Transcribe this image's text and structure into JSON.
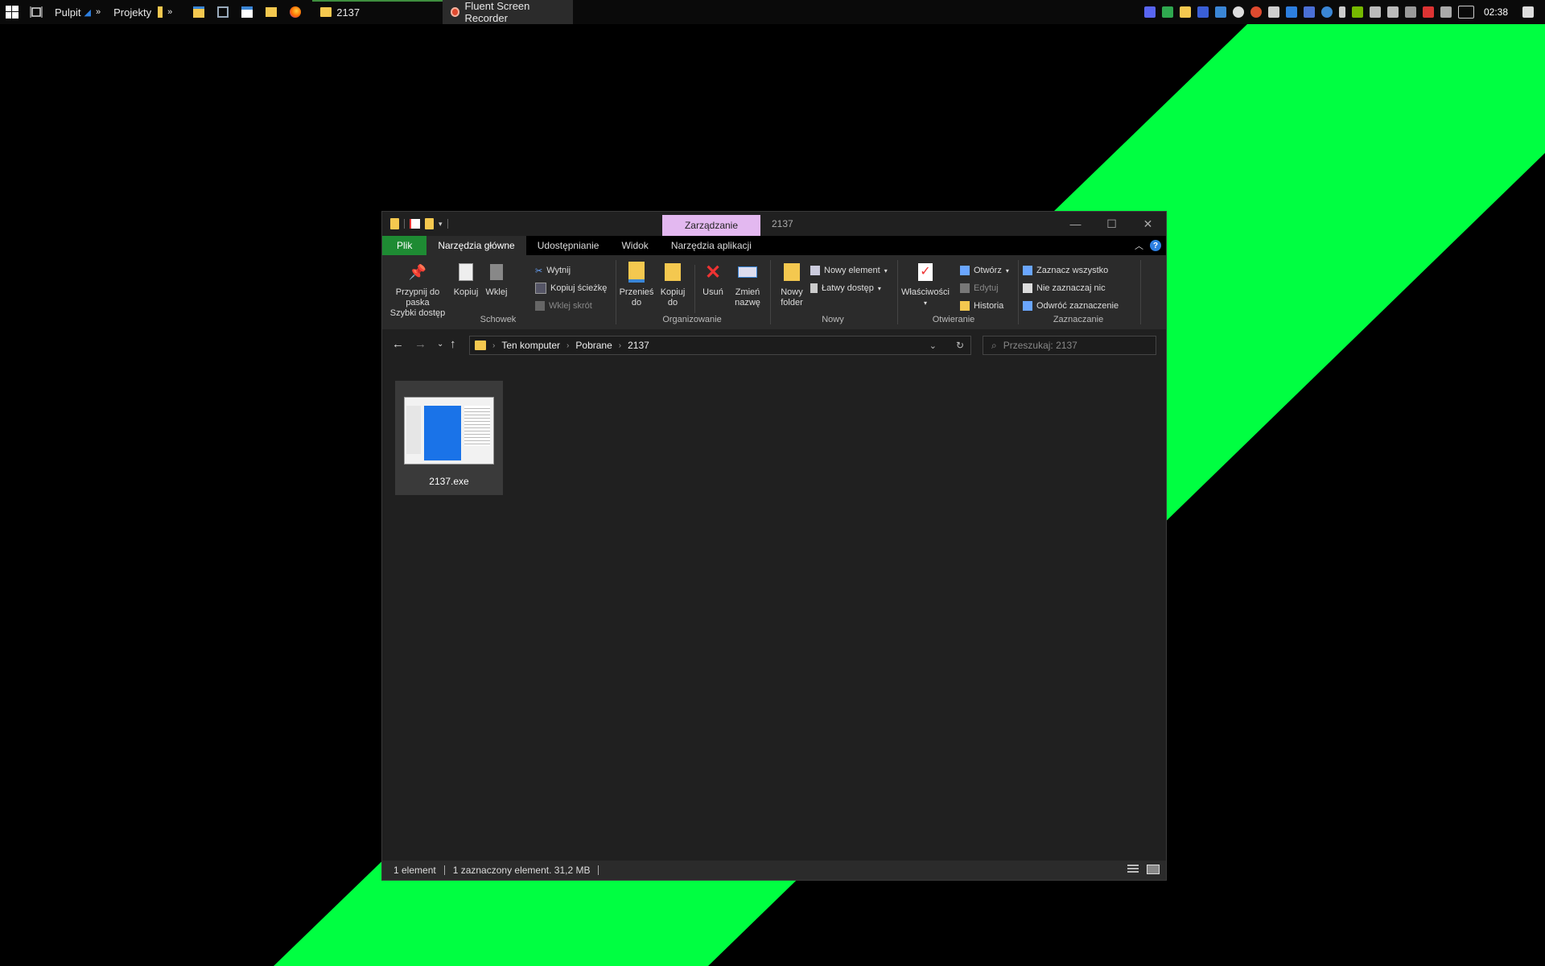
{
  "taskbar": {
    "start_icon": "windows-logo-icon",
    "task_view_icon": "task-view-icon",
    "toolbars": [
      {
        "label": "Pulpit",
        "overflow": "»"
      },
      {
        "label": "Projekty",
        "overflow": "»"
      }
    ],
    "pinned_icons": [
      "file-explorer-icon",
      "computer-icon",
      "calendar-icon",
      "folder-icon",
      "firefox-icon"
    ],
    "apps": [
      {
        "label": "2137",
        "icon": "folder-icon"
      },
      {
        "label": "Fluent Screen Recorder",
        "icon": "screen-recorder-icon"
      }
    ],
    "clock": "02:38"
  },
  "window": {
    "title": "2137",
    "contextual_tab": "Zarządzanie",
    "ribbon_tabs": [
      "Plik",
      "Narzędzia główne",
      "Udostępnianie",
      "Widok",
      "Narzędzia aplikacji"
    ],
    "help_label": "?",
    "clipboard": {
      "pin_label_1": "Przypnij do paska",
      "pin_label_2": "Szybki dostęp",
      "copy_label": "Kopiuj",
      "paste_label": "Wklej",
      "cut_label": "Wytnij",
      "copy_path_label": "Kopiuj ścieżkę",
      "paste_shortcut_label": "Wklej skrót",
      "group_label": "Schowek"
    },
    "organize": {
      "move_label_1": "Przenieś",
      "move_label_2": "do",
      "copyto_label_1": "Kopiuj",
      "copyto_label_2": "do",
      "delete_label": "Usuń",
      "rename_label_1": "Zmień",
      "rename_label_2": "nazwę",
      "group_label": "Organizowanie"
    },
    "new": {
      "new_folder_label_1": "Nowy",
      "new_folder_label_2": "folder",
      "new_item_label": "Nowy element",
      "easy_access_label": "Łatwy dostęp",
      "group_label": "Nowy"
    },
    "open": {
      "properties_label": "Właściwości",
      "open_label": "Otwórz",
      "edit_label": "Edytuj",
      "history_label": "Historia",
      "group_label": "Otwieranie"
    },
    "select": {
      "select_all_label": "Zaznacz wszystko",
      "select_none_label": "Nie zaznaczaj nic",
      "invert_label": "Odwróć zaznaczenie",
      "group_label": "Zaznaczanie"
    },
    "address": {
      "breadcrumbs": [
        "Ten komputer",
        "Pobrane",
        "2137"
      ]
    },
    "search": {
      "placeholder": "Przeszukaj: 2137"
    },
    "files": [
      {
        "name": "2137.exe",
        "selected": true
      }
    ],
    "status": {
      "count": "1 element",
      "selection": "1 zaznaczony element. 31,2 MB"
    }
  },
  "colors": {
    "wallpaper_accent": "#00ff41",
    "file_tab": "#1e8b33",
    "contextual_tab": "#e3b8f0"
  }
}
